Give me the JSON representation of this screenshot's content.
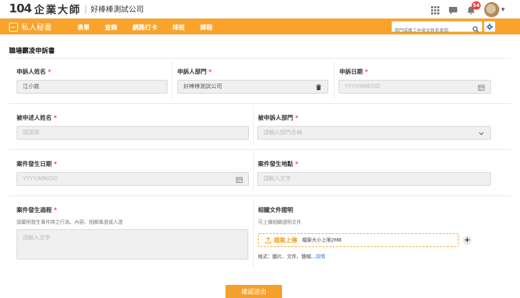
{
  "header": {
    "logo_number": "104",
    "logo_brand": "企業大師",
    "company_name": "好棒棒測試公司",
    "notification_count": "54"
  },
  "nav": {
    "home_label": "私人秘書",
    "items": [
      "表單",
      "查詢",
      "網路打卡",
      "排班",
      "課程"
    ],
    "search_placeholder": "部門或員工中英文姓名查詢"
  },
  "form": {
    "title": "職場霸凌申訴書",
    "complainant_name": {
      "label": "申訴人姓名",
      "value": "江小庭"
    },
    "complainant_dept": {
      "label": "申訴人部門",
      "value": "好棒棒測試公司"
    },
    "complaint_date": {
      "label": "申訴日期",
      "placeholder": "YYYY/MM/DD"
    },
    "respondent_name": {
      "label": "被申述人姓名",
      "placeholder": "請選擇"
    },
    "respondent_dept": {
      "label": "被申訴人部門",
      "placeholder": "請輸入部門名稱"
    },
    "incident_date": {
      "label": "案件發生日期",
      "placeholder": "YYYY/MM/DD"
    },
    "incident_location": {
      "label": "案件發生地點",
      "placeholder": "請輸入文字"
    },
    "incident_process": {
      "label": "案件發生過程",
      "hint": "請載明發生事件時之行為、內容、相關事證或人證",
      "placeholder": "請輸入文字"
    },
    "documents": {
      "label": "相關文件證明",
      "hint": "可上傳相關證明文件",
      "upload_label": "檔案上傳",
      "size_hint": "檔案大小上限2MB",
      "format_text": "格式：圖片、文件、聲帽...",
      "detail_link": "詳情"
    },
    "required_mark": "*",
    "submit_label": "確認送出"
  },
  "colors": {
    "brand_orange": "#f9a32b",
    "required_red": "#e8443a",
    "link_blue": "#2f7ad6"
  }
}
